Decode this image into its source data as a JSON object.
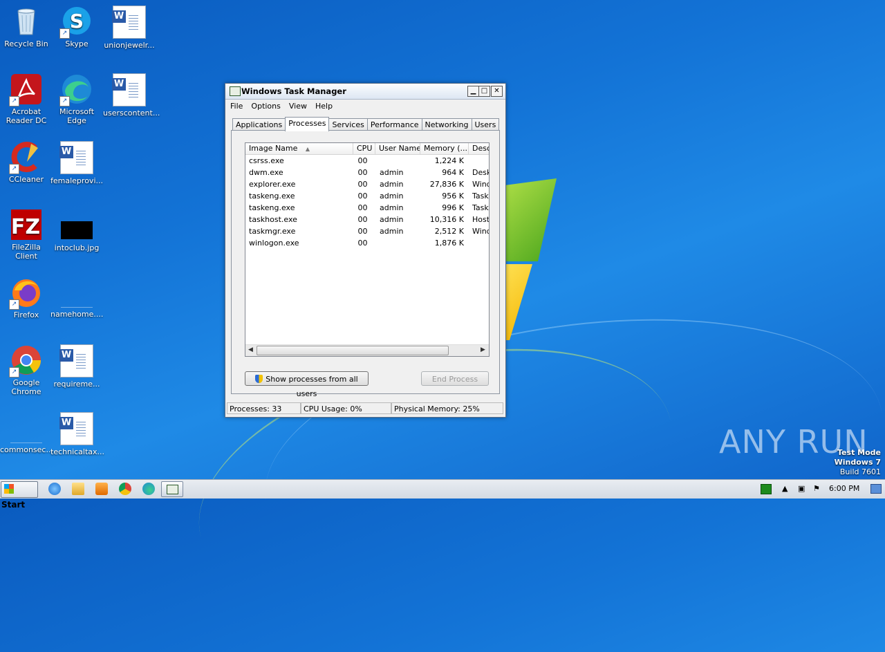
{
  "desktop": {
    "icons": [
      {
        "label": "Recycle Bin"
      },
      {
        "label": "Skype"
      },
      {
        "label": "unionjewelr..."
      },
      {
        "label": "Acrobat\nReader DC"
      },
      {
        "label": "Microsoft Edge"
      },
      {
        "label": "userscontent..."
      },
      {
        "label": "CCleaner"
      },
      {
        "label": "femaleprovi..."
      },
      {
        "label": "FileZilla Client"
      },
      {
        "label": "intoclub.jpg"
      },
      {
        "label": "Firefox"
      },
      {
        "label": "namehome...."
      },
      {
        "label": "Google\nChrome"
      },
      {
        "label": "requireme..."
      },
      {
        "label": "commonsec..."
      },
      {
        "label": "technicaltax..."
      }
    ],
    "watermark": "ANY RUN",
    "test_mode": {
      "line1": "Test Mode",
      "line2": "Windows 7",
      "line3": "Build 7601"
    }
  },
  "window": {
    "title": "Windows Task Manager",
    "menu": [
      "File",
      "Options",
      "View",
      "Help"
    ],
    "tabs": [
      "Applications",
      "Processes",
      "Services",
      "Performance",
      "Networking",
      "Users"
    ],
    "active_tab": "Processes",
    "columns": [
      "Image Name",
      "CPU",
      "User Name",
      "Memory (...",
      "Desc"
    ],
    "rows": [
      {
        "name": "csrss.exe",
        "cpu": "00",
        "user": "",
        "mem": "1,224 K",
        "desc": ""
      },
      {
        "name": "dwm.exe",
        "cpu": "00",
        "user": "admin",
        "mem": "964 K",
        "desc": "Desk"
      },
      {
        "name": "explorer.exe",
        "cpu": "00",
        "user": "admin",
        "mem": "27,836 K",
        "desc": "Wind"
      },
      {
        "name": "taskeng.exe",
        "cpu": "00",
        "user": "admin",
        "mem": "956 K",
        "desc": "Task"
      },
      {
        "name": "taskeng.exe",
        "cpu": "00",
        "user": "admin",
        "mem": "996 K",
        "desc": "Task"
      },
      {
        "name": "taskhost.exe",
        "cpu": "00",
        "user": "admin",
        "mem": "10,316 K",
        "desc": "Host"
      },
      {
        "name": "taskmgr.exe",
        "cpu": "00",
        "user": "admin",
        "mem": "2,512 K",
        "desc": "Wind"
      },
      {
        "name": "winlogon.exe",
        "cpu": "00",
        "user": "",
        "mem": "1,876 K",
        "desc": ""
      }
    ],
    "show_all_label": "Show processes from all users",
    "end_process_label": "End Process",
    "status": {
      "processes": "Processes: 33",
      "cpu": "CPU Usage: 0%",
      "memory": "Physical Memory: 25%"
    }
  },
  "taskbar": {
    "start_label": "Start",
    "clock": "6:00 PM"
  }
}
